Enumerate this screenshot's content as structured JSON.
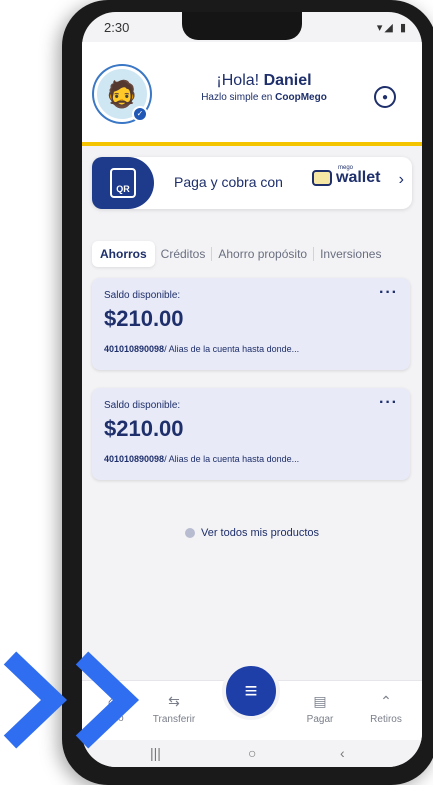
{
  "status": {
    "time": "2:30",
    "right": "▾◢ ▮"
  },
  "header": {
    "greeting_prefix": "¡Hola!",
    "user_name": "Daniel",
    "subtitle_prefix": "Hazlo simple en",
    "brand": "CoopMego"
  },
  "wallet": {
    "qr_label": "QR",
    "text": "Paga y cobra con",
    "logo_small": "mego",
    "logo_text": "wallet",
    "chevron": "›"
  },
  "tabs": [
    {
      "label": "Ahorros",
      "active": true
    },
    {
      "label": "Créditos",
      "active": false
    },
    {
      "label": "Ahorro propósito",
      "active": false
    },
    {
      "label": "Inversiones",
      "active": false
    }
  ],
  "accounts": [
    {
      "label": "Saldo disponible:",
      "amount": "$210.00",
      "number": "401010890098",
      "alias": "/ Alias de la cuenta hasta donde..."
    },
    {
      "label": "Saldo disponible:",
      "amount": "$210.00",
      "number": "401010890098",
      "alias": "/ Alias de la cuenta hasta donde..."
    }
  ],
  "see_all": "Ver todos mis productos",
  "nav": {
    "home": "Inicio",
    "transfer": "Transferir",
    "pay": "Pagar",
    "withdraw": "Retiros"
  },
  "colors": {
    "primary": "#1e2f6b",
    "accent_blue": "#1e3fa8",
    "gold": "#f4c400",
    "overlay_chevron": "#2f6ef0"
  },
  "icons": {
    "avatar": "avatar-emoji",
    "eye": "eye-icon",
    "menu": "menu-icon",
    "home": "home-icon",
    "transfer": "transfer-arrows-icon",
    "pay": "receipt-icon",
    "withdraw": "double-chevron-up-icon"
  }
}
